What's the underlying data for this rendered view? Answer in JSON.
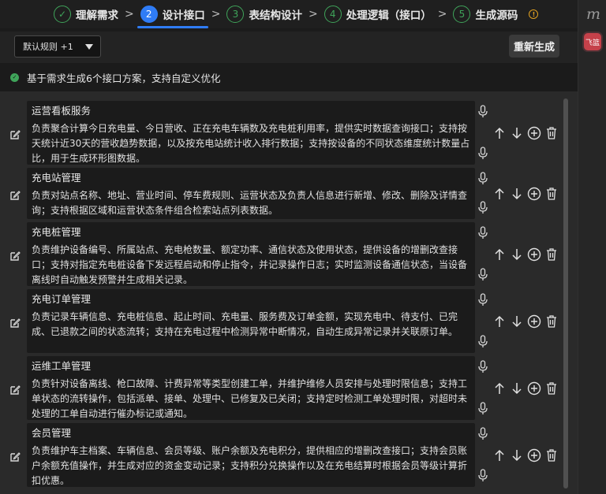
{
  "steps": [
    {
      "num": "✓",
      "label": "理解需求",
      "state": "done"
    },
    {
      "num": "2",
      "label": "设计接口",
      "state": "active"
    },
    {
      "num": "3",
      "label": "表结构设计",
      "state": "todo"
    },
    {
      "num": "4",
      "label": "处理逻辑（接口）",
      "state": "todo"
    },
    {
      "num": "5",
      "label": "生成源码",
      "state": "todo"
    }
  ],
  "rail": {
    "logo": "m",
    "app_badge": "飞篮"
  },
  "toolbar": {
    "rule_select": "默认规则 +1",
    "regen_label": "重新生成"
  },
  "notice": {
    "text": "基于需求生成6个接口方案，支持自定义优化"
  },
  "interfaces": [
    {
      "title": "运营看板服务",
      "desc": "负责聚合计算今日充电量、今日营收、正在充电车辆数及充电桩利用率，提供实时数据查询接口；支持按天统计近30天的营收趋势数据，以及按充电站统计收入排行数据；支持按设备的不同状态维度统计数量占比，用于生成环形图数据。"
    },
    {
      "title": "充电站管理",
      "desc": "负责对站点名称、地址、营业时间、停车费规则、运营状态及负责人信息进行新增、修改、删除及详情查询；支持根据区域和运营状态条件组合检索站点列表数据。"
    },
    {
      "title": "充电桩管理",
      "desc": "负责维护设备编号、所属站点、充电枪数量、额定功率、通信状态及使用状态，提供设备的增删改查接口；支持对指定充电桩设备下发远程启动和停止指令，并记录操作日志；实时监测设备通信状态，当设备离线时自动触发预警并生成相关记录。"
    },
    {
      "title": "充电订单管理",
      "desc": "负责记录车辆信息、充电桩信息、起止时间、充电量、服务费及订单金额，实现充电中、待支付、已完成、已退款之间的状态流转；支持在充电过程中检测异常中断情况，自动生成异常记录并关联原订单。"
    },
    {
      "title": "运维工单管理",
      "desc": "负责针对设备离线、枪口故障、计费异常等类型创建工单，并维护维修人员安排与处理时限信息；支持工单状态的流转操作，包括派单、接单、处理中、已修复及已关闭；支持定时检测工单处理时限，对超时未处理的工单自动进行催办标记或通知。"
    },
    {
      "title": "会员管理",
      "desc": "负责维护车主档案、车辆信息、会员等级、账户余额及充电积分，提供相应的增删改查接口；支持会员账户余额充值操作，并生成对应的资金变动记录；支持积分兑换操作以及在充电结算时根据会员等级计算折扣优惠。"
    }
  ]
}
